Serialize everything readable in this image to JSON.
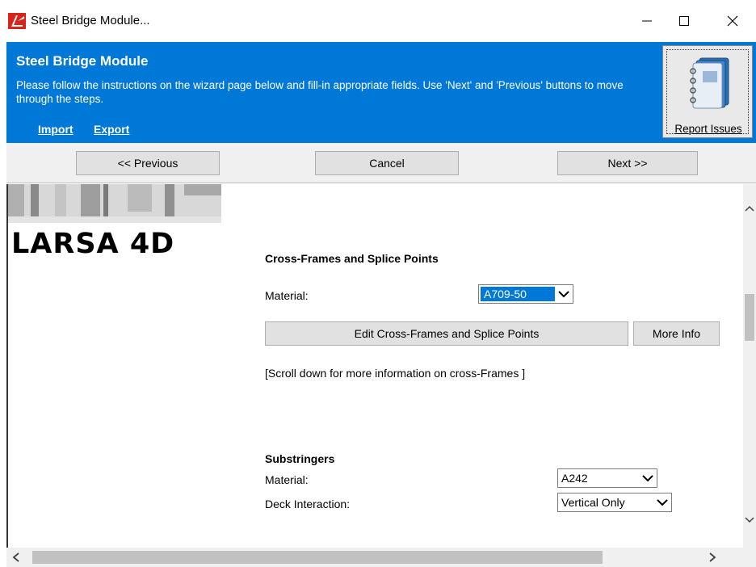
{
  "window": {
    "title": "Steel Bridge Module...",
    "icon": "larsa-app-icon",
    "controls": [
      "minimize-icon",
      "maximize-icon",
      "close-icon"
    ]
  },
  "header": {
    "title": "Steel Bridge Module",
    "description": "Please follow the instructions on the wizard page below and fill-in appropriate fields. Use 'Next' and 'Previous' buttons to move through the steps.",
    "links": {
      "import": "Import",
      "export": "Export"
    },
    "report_issues": "Report Issues",
    "background_color": "#0078d7"
  },
  "nav": {
    "previous": "<< Previous",
    "cancel": "Cancel",
    "next": "Next >>"
  },
  "content": {
    "logo": "LARSA 4D",
    "cross_frames": {
      "title": "Cross-Frames and Splice Points",
      "material_label": "Material:",
      "material_value": "A709-50",
      "edit_button": "Edit Cross-Frames and Splice Points",
      "more_info_button": "More Info",
      "note": "[Scroll down for more information on cross-Frames ]"
    },
    "substringers": {
      "title": "Substringers",
      "material_label": "Material:",
      "material_value": "A242",
      "deck_label": "Deck Interaction:",
      "deck_value": "Vertical Only"
    }
  }
}
